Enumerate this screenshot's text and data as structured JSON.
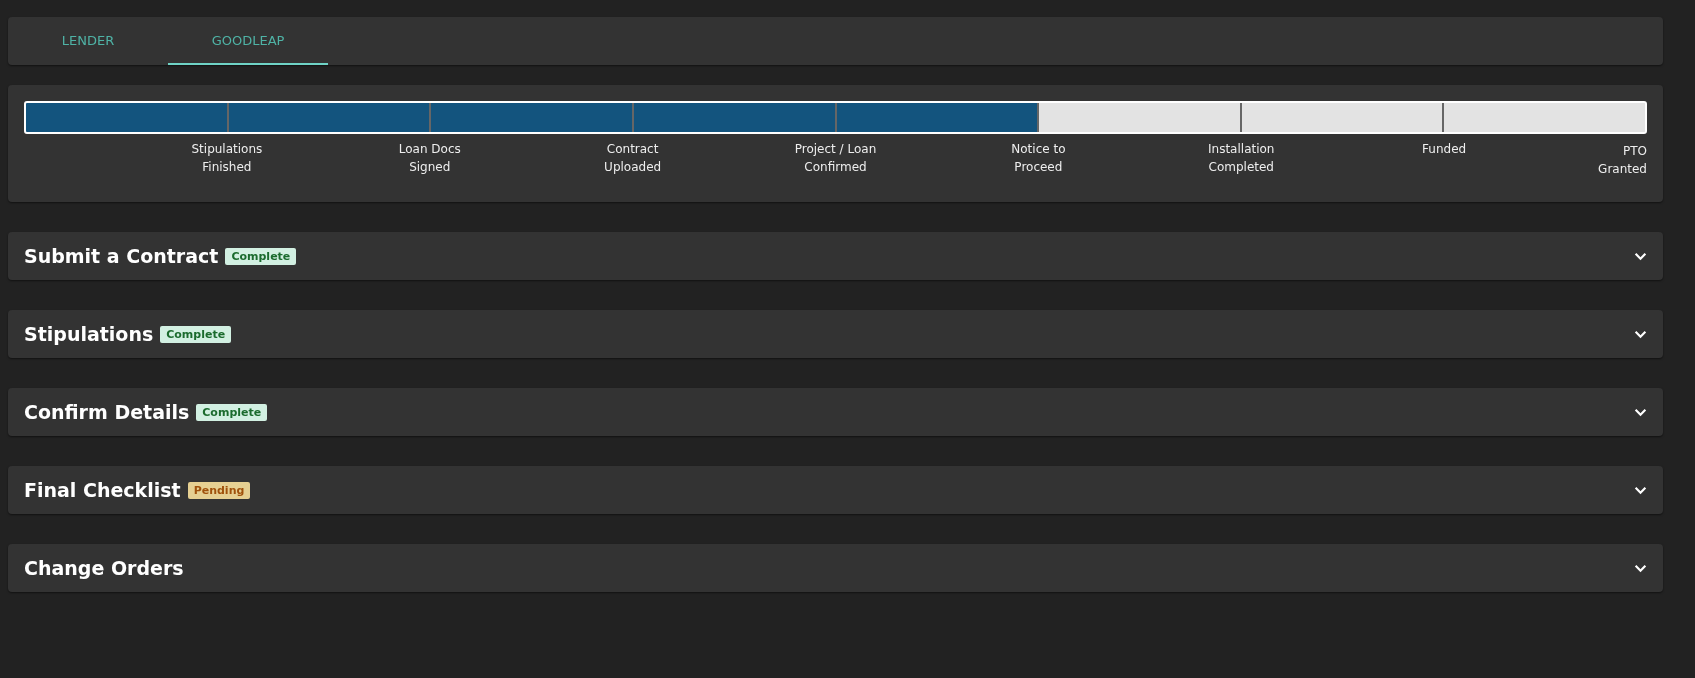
{
  "tabs": [
    {
      "label": "LENDER",
      "selected": false
    },
    {
      "label": "GOODLEAP",
      "selected": true
    }
  ],
  "progress": {
    "steps": [
      {
        "done": true,
        "label_lines": [
          "Stipulations",
          "Finished"
        ]
      },
      {
        "done": true,
        "label_lines": [
          "Loan Docs",
          "Signed"
        ]
      },
      {
        "done": true,
        "label_lines": [
          "Contract",
          "Uploaded"
        ]
      },
      {
        "done": true,
        "label_lines": [
          "Project / Loan",
          "Confirmed"
        ]
      },
      {
        "done": true,
        "label_lines": [
          "Notice to",
          "Proceed"
        ]
      },
      {
        "done": false,
        "label_lines": [
          "Installation",
          "Completed"
        ]
      },
      {
        "done": false,
        "label_lines": [
          "Funded"
        ]
      },
      {
        "done": false,
        "label_lines": [
          "PTO",
          "Granted"
        ]
      }
    ]
  },
  "sections": [
    {
      "title": "Submit a Contract",
      "status": {
        "kind": "complete",
        "label": "Complete"
      },
      "expanded": false
    },
    {
      "title": "Stipulations",
      "status": {
        "kind": "complete",
        "label": "Complete"
      },
      "expanded": false
    },
    {
      "title": "Confirm Details",
      "status": {
        "kind": "complete",
        "label": "Complete"
      },
      "expanded": false
    },
    {
      "title": "Final Checklist",
      "status": {
        "kind": "pending",
        "label": "Pending"
      },
      "expanded": false
    },
    {
      "title": "Change Orders",
      "expanded": false
    }
  ]
}
